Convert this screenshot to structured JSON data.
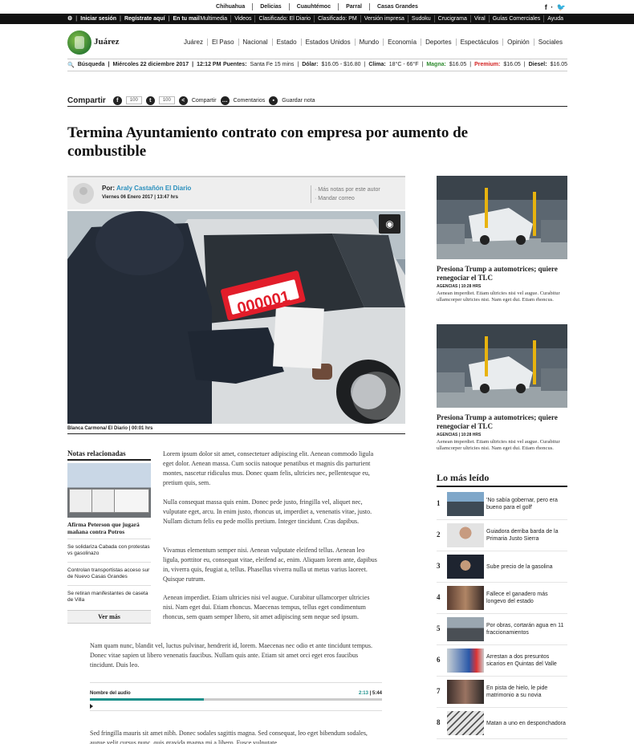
{
  "top_cities": [
    "Chihuahua",
    "Delicias",
    "Cuauhtémoc",
    "Parral",
    "Casas Grandes"
  ],
  "social_top": "f · 🐦",
  "blackbar": {
    "login": "Iniciar sesión",
    "register": "Regístrate aquí",
    "email": "En tu mail",
    "links": [
      "Multimedia",
      "Videos",
      "Clasificado: El Diario",
      "Clasificado: PM",
      "Versión impresa",
      "Sudoku",
      "Crucigrama",
      "Viral",
      "Guías Comerciales",
      "Ayuda"
    ]
  },
  "logo_text": "Juárez",
  "nav": [
    "Juárez",
    "El Paso",
    "Nacional",
    "Estado",
    "Estados Unidos",
    "Mundo",
    "Economía",
    "Deportes",
    "Espectáculos",
    "Opinión",
    "Sociales"
  ],
  "infobar": {
    "search": "Búsqueda",
    "date": "Miércoles 22 diciembre 2017",
    "time": "12:12 PM",
    "puentes_label": "Puentes:",
    "puentes": "Santa Fe 15 mins",
    "dolar_label": "Dólar:",
    "dolar": "$16.05 - $16.80",
    "clima_label": "Clima:",
    "clima": "18°C - 66°F",
    "magna_label": "Magna:",
    "magna": "$16.05",
    "premium_label": "Premium:",
    "premium": "$16.05",
    "diesel_label": "Diesel:",
    "diesel": "$16.05"
  },
  "share": {
    "label": "Compartir",
    "fb_count": "100",
    "tw_count": "100",
    "compartir": "Compartir",
    "comentarios": "Comentarios",
    "guardar": "Guardar nota"
  },
  "headline": "Termina Ayuntamiento contrato con empresa por aumento de combustible",
  "author": {
    "por": "Por:",
    "name": "Araly Castañón El Diario",
    "date": "Viernes 06 Enero 2017 | 13:47 hrs",
    "more_notes": "· Más notas por este autor",
    "send_mail": "· Mandar correo"
  },
  "photo_plate": "000001",
  "caption": "Blanca Carmona/ El Diario | 00:01 hrs",
  "related": {
    "title": "Notas relacionadas",
    "main": "Afirma Peterson que jugará mañana contra Potros",
    "items": [
      "Se solidariza Cabada con protestas vs gasolinazo",
      "Controlan transportistas acceso sur de Nuevo Casas Grandes",
      "Se retiran manifestantes de caseta de Villa"
    ],
    "more": "Ver más"
  },
  "body": [
    "Lorem ipsum dolor sit amet, consectetuer adipiscing elit. Aenean commodo ligula eget dolor. Aenean massa. Cum sociis natoque penatibus et magnis dis parturient montes, nascetur ridiculus mus. Donec quam felis, ultricies nec, pellentesque eu, pretium quis, sem.",
    "Nulla consequat massa quis enim. Donec pede justo, fringilla vel, aliquet nec, vulputate eget, arcu. In enim justo, rhoncus ut, imperdiet a, venenatis vitae, justo. Nullam dictum felis eu pede mollis pretium. Integer tincidunt. Cras dapibus.",
    "Vivamus elementum semper nisi. Aenean vulputate eleifend tellus. Aenean leo ligula, porttitor eu, consequat vitae, eleifend ac, enim. Aliquam lorem ante, dapibus in, viverra quis, feugiat a, tellus. Phasellus viverra nulla ut metus varius laoreet. Quisque rutrum.",
    "Aenean imperdiet. Etiam ultricies nisi vel augue. Curabitur ullamcorper ultricies nisi. Nam eget dui. Etiam rhoncus. Maecenas tempus, tellus eget condimentum rhoncus, sem quam semper libero, sit amet adipiscing sem neque sed ipsum.",
    "Nam quam nunc, blandit vel, luctus pulvinar, hendrerit id, lorem. Maecenas nec odio et ante tincidunt tempus. Donec vitae sapien ut libero venenatis faucibus. Nullam quis ante. Etiam sit amet orci eget eros faucibus tincidunt. Duis leo.",
    "Sed fringilla mauris sit amet nibh. Donec sodales sagittis magna. Sed consequat, leo eget bibendum sodales, augue velit cursus nunc, quis gravida magna mi a libero. Fusce vulputate"
  ],
  "audio": {
    "name": "Nombre del audio",
    "current": "2:13",
    "total": "5:44",
    "progress": 0.39
  },
  "side_news": [
    {
      "headline": "Presiona Trump a automotrices; quiere renegociar el TLC",
      "tag": "AGENCIAS | 10:28 HRS",
      "text": "Aenean imperdiet. Etiam ultricies nisi vel augue. Curabitur ullamcorper ultricies nisi. Nam eget dui. Etiam rhoncus."
    },
    {
      "headline": "Presiona Trump a automotrices; quiere renegociar el TLC",
      "tag": "AGENCIAS | 10:28 HRS",
      "text": "Aenean imperdiet. Etiam ultricies nisi vel augue. Curabitur ullamcorper ultricies nisi. Nam eget dui. Etiam rhoncus."
    }
  ],
  "mas_leido": {
    "title": "Lo más leído",
    "items": [
      {
        "n": "1",
        "t": "'No sabía gobernar, pero era bueno para el golf'"
      },
      {
        "n": "2",
        "t": "Guiadora derriba barda de la Primaria Justo Sierra"
      },
      {
        "n": "3",
        "t": "Sube precio de la gasolina"
      },
      {
        "n": "4",
        "t": "Fallece el ganadero más longevo del estado"
      },
      {
        "n": "5",
        "t": "Por obras, cortarán agua en 11 fraccionamientos"
      },
      {
        "n": "6",
        "t": "Arrestan a dos presuntos sicarios en Quintas del Valle"
      },
      {
        "n": "7",
        "t": "En pista de hielo, le pide matrimonio a su novia"
      },
      {
        "n": "8",
        "t": "Matan a uno en desponchadora"
      }
    ]
  }
}
